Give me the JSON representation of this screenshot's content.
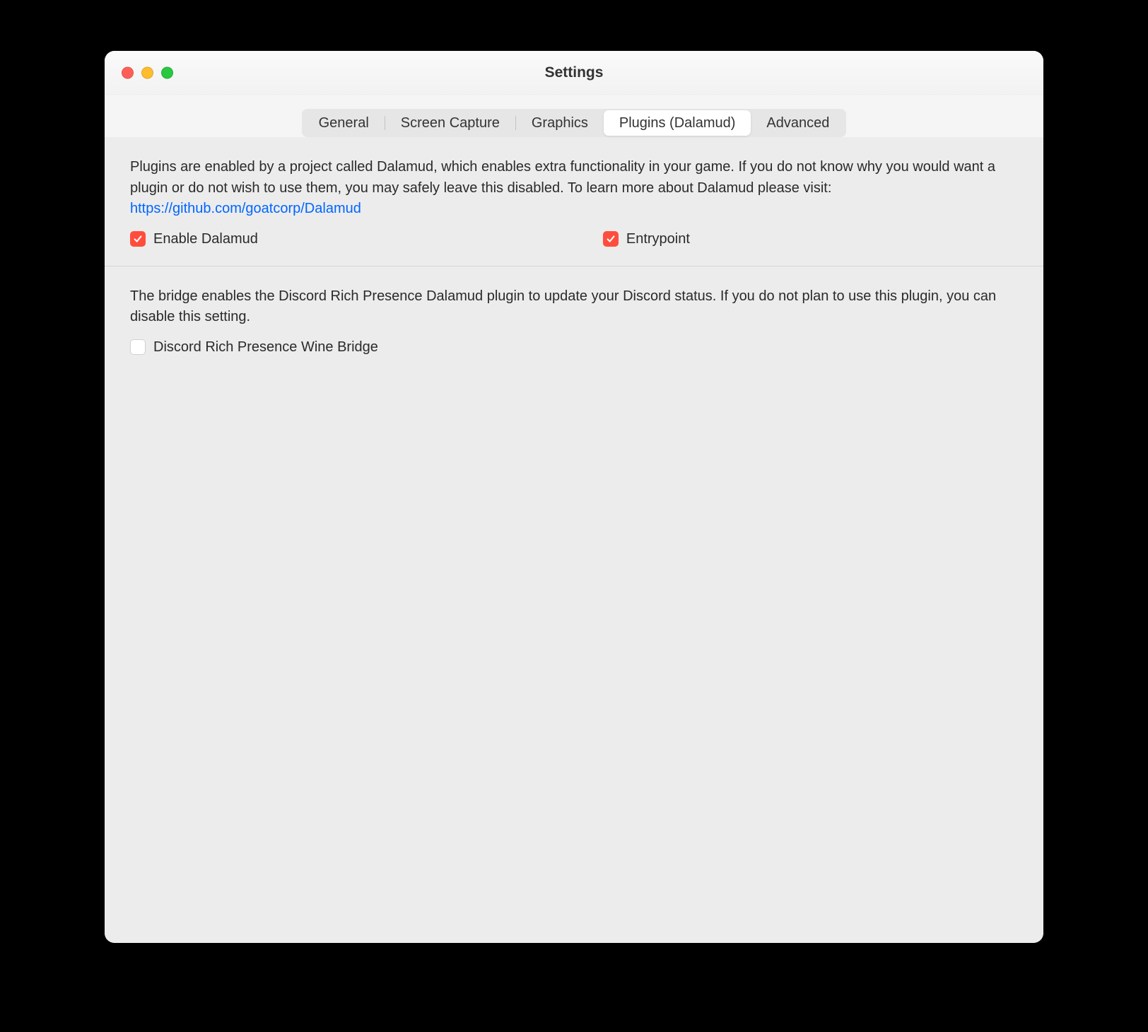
{
  "window": {
    "title": "Settings"
  },
  "tabs": {
    "general": "General",
    "screen_capture": "Screen Capture",
    "graphics": "Graphics",
    "plugins": "Plugins (Dalamud)",
    "advanced": "Advanced"
  },
  "plugins_section": {
    "description": "Plugins are enabled by a project called Dalamud, which enables extra functionality in your game. If you do not know why you would want a plugin or do not wish to use them, you may safely leave this disabled. To learn more about Dalamud please visit:",
    "link_text": "https://github.com/goatcorp/Dalamud",
    "enable_dalamud_label": "Enable Dalamud",
    "enable_dalamud_checked": true,
    "entrypoint_label": "Entrypoint",
    "entrypoint_checked": true
  },
  "bridge_section": {
    "description": "The bridge enables the Discord Rich Presence Dalamud plugin to update your Discord status. If you do not plan to use this plugin, you can disable this setting.",
    "discord_bridge_label": "Discord Rich Presence Wine Bridge",
    "discord_bridge_checked": false
  },
  "colors": {
    "accent": "#ff4d3d",
    "link": "#0066ff"
  }
}
